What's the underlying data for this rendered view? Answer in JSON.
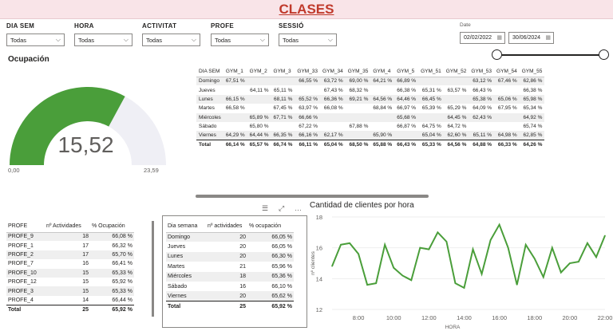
{
  "title": "CLASES",
  "slicers": [
    {
      "label": "DIA SEM",
      "value": "Todas"
    },
    {
      "label": "HORA",
      "value": "Todas"
    },
    {
      "label": "ACTIVITAT",
      "value": "Todas"
    },
    {
      "label": "PROFE",
      "value": "Todas"
    },
    {
      "label": "SESSIÓ",
      "value": "Todas"
    }
  ],
  "date_filter": {
    "label": "Date",
    "start": "02/02/2022",
    "end": "30/06/2024"
  },
  "gauge": {
    "title": "Ocupación",
    "value": "15,52",
    "min": "0,00",
    "max": "23,59",
    "value_num": 15.52,
    "min_num": 0,
    "max_num": 23.59,
    "fill_color": "#4a9e3a",
    "track_color": "#efeff5"
  },
  "matrix": {
    "columns": [
      "DIA SEM",
      "GYM_1",
      "GYM_2",
      "GYM_3",
      "GYM_33",
      "GYM_34",
      "GYM_35",
      "GYM_4",
      "GYM_5",
      "GYM_51",
      "GYM_52",
      "GYM_53",
      "GYM_54",
      "GYM_55"
    ],
    "rows": [
      [
        "Domingo",
        "67,51 %",
        "",
        "",
        "66,55 %",
        "63,72 %",
        "69,00 %",
        "64,21 %",
        "66,89 %",
        "",
        "",
        "63,12 %",
        "67,46 %",
        "62,86 %"
      ],
      [
        "Jueves",
        "",
        "64,11 %",
        "65,11 %",
        "",
        "67,43 %",
        "68,32 %",
        "",
        "66,38 %",
        "65,31 %",
        "63,57 %",
        "66,43 %",
        "",
        "66,38 %"
      ],
      [
        "Lunes",
        "66,15 %",
        "",
        "68,11 %",
        "65,52 %",
        "66,36 %",
        "69,21 %",
        "64,56 %",
        "64,46 %",
        "66,45 %",
        "",
        "65,38 %",
        "65,06 %",
        "65,98 %"
      ],
      [
        "Martes",
        "66,58 %",
        "",
        "67,45 %",
        "63,97 %",
        "66,08 %",
        "",
        "68,84 %",
        "66,97 %",
        "65,39 %",
        "65,29 %",
        "64,09 %",
        "67,95 %",
        "65,34 %"
      ],
      [
        "Miércoles",
        "",
        "65,89 %",
        "67,71 %",
        "66,66 %",
        "",
        "",
        "",
        "65,68 %",
        "",
        "64,45 %",
        "62,43 %",
        "",
        "64,92 %"
      ],
      [
        "Sábado",
        "",
        "65,80 %",
        "",
        "67,22 %",
        "",
        "67,88 %",
        "",
        "66,87 %",
        "64,75 %",
        "64,72 %",
        "",
        "",
        "65,74 %"
      ],
      [
        "Viernes",
        "64,29 %",
        "64,44 %",
        "66,35 %",
        "66,16 %",
        "62,17 %",
        "",
        "65,90 %",
        "",
        "65,04 %",
        "62,60 %",
        "65,11 %",
        "64,98 %",
        "62,85 %"
      ]
    ],
    "total": [
      "Total",
      "66,14 %",
      "65,57 %",
      "66,74 %",
      "66,11 %",
      "65,04 %",
      "68,50 %",
      "65,88 %",
      "66,43 %",
      "65,33 %",
      "64,56 %",
      "64,88 %",
      "66,33 %",
      "64,26 %"
    ]
  },
  "profe_table": {
    "columns": [
      "PROFE",
      "nº Actividades",
      "% Ocupación"
    ],
    "rows": [
      [
        "PROFE_9",
        "18",
        "66,08 %"
      ],
      [
        "PROFE_1",
        "17",
        "66,32 %"
      ],
      [
        "PROFE_2",
        "17",
        "65,70 %"
      ],
      [
        "PROFE_7",
        "16",
        "66,41 %"
      ],
      [
        "PROFE_10",
        "15",
        "65,33 %"
      ],
      [
        "PROFE_12",
        "15",
        "65,92 %"
      ],
      [
        "PROFE_3",
        "15",
        "65,33 %"
      ],
      [
        "PROFE_4",
        "14",
        "66,44 %"
      ]
    ],
    "total": [
      "Total",
      "25",
      "65,92 %"
    ]
  },
  "day_table": {
    "columns": [
      "Dia semana",
      "nº actividades",
      "% ocupación"
    ],
    "rows": [
      [
        "Domingo",
        "20",
        "66,05 %"
      ],
      [
        "Jueves",
        "20",
        "66,05 %"
      ],
      [
        "Lunes",
        "20",
        "66,30 %"
      ],
      [
        "Martes",
        "21",
        "65,96 %"
      ],
      [
        "Miércoles",
        "18",
        "65,36 %"
      ],
      [
        "Sábado",
        "16",
        "66,10 %"
      ],
      [
        "Viernes",
        "20",
        "65,62 %"
      ]
    ],
    "total": [
      "Total",
      "25",
      "65,92 %"
    ]
  },
  "chart_data": {
    "type": "line",
    "title": "Cantidad de clientes por hora",
    "xlabel": "HORA",
    "ylabel": "nº clientes",
    "x_ticks": [
      "8:00",
      "10:00",
      "12:00",
      "14:00",
      "16:00",
      "18:00",
      "20:00",
      "22:00"
    ],
    "y_ticks": [
      12,
      14,
      16,
      18
    ],
    "ylim": [
      12,
      18
    ],
    "xlim": [
      6.5,
      22
    ],
    "color": "#4a9e3a",
    "x": [
      6.5,
      7,
      7.5,
      8,
      8.5,
      9,
      9.5,
      10,
      10.5,
      11,
      11.5,
      12,
      12.5,
      13,
      13.5,
      14,
      14.5,
      15,
      15.5,
      16,
      16.5,
      17,
      17.5,
      18,
      18.5,
      19,
      19.5,
      20,
      20.5,
      21,
      21.5,
      22
    ],
    "values": [
      14.8,
      16.2,
      16.3,
      15.6,
      13.6,
      13.7,
      16.2,
      14.7,
      14.2,
      13.9,
      16.0,
      15.9,
      17.0,
      16.4,
      13.7,
      13.4,
      15.9,
      14.3,
      16.5,
      17.5,
      16.0,
      13.6,
      16.2,
      15.3,
      14.1,
      16.0,
      14.4,
      15.0,
      15.1,
      16.3,
      15.4,
      16.8
    ]
  }
}
